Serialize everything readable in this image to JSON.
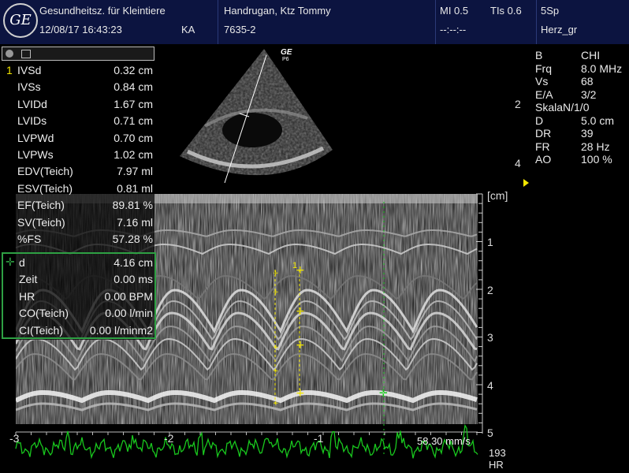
{
  "header": {
    "logo_text": "GE",
    "institution": "Gesundheitsz. für Kleintiere",
    "datetime": "12/08/17 16:43:23",
    "operator": "KA",
    "patient": "Handrugan, Ktz Tommy",
    "patient_id": "7635-2",
    "mi": "MI 0.5",
    "tis": "TIs 0.6",
    "placeholder": "--:--:--",
    "probe": "5Sp",
    "preset": "Herz_gr"
  },
  "probe_label": {
    "brand": "GE",
    "sub": "P6"
  },
  "measurements": [
    {
      "index": "1",
      "label": "IVSd",
      "value": "0.32 cm"
    },
    {
      "index": "",
      "label": "IVSs",
      "value": "0.84 cm"
    },
    {
      "index": "",
      "label": "LVIDd",
      "value": "1.67 cm"
    },
    {
      "index": "",
      "label": "LVIDs",
      "value": "0.71 cm"
    },
    {
      "index": "",
      "label": "LVPWd",
      "value": "0.70 cm"
    },
    {
      "index": "",
      "label": "LVPWs",
      "value": "1.02 cm"
    },
    {
      "index": "",
      "label": "EDV(Teich)",
      "value": "7.97 ml"
    },
    {
      "index": "",
      "label": "ESV(Teich)",
      "value": "0.81 ml"
    },
    {
      "index": "",
      "label": "EF(Teich)",
      "value": "89.81 %"
    },
    {
      "index": "",
      "label": "SV(Teich)",
      "value": "7.16 ml"
    },
    {
      "index": "",
      "label": "%FS",
      "value": "57.28 %"
    }
  ],
  "calipers": [
    {
      "label": "d",
      "value": "4.16 cm"
    },
    {
      "label": "Zeit",
      "value": "0.00 ms"
    },
    {
      "label": "HR",
      "value": "0.00 BPM"
    },
    {
      "label": "CO(Teich)",
      "value": "0.00 l/min"
    },
    {
      "label": "CI(Teich)",
      "value": "0.00 l/minm2"
    }
  ],
  "params": [
    {
      "label": "B",
      "value": "CHI"
    },
    {
      "label": "Frq",
      "value": "8.0 MHz"
    },
    {
      "label": "Vs",
      "value": "68"
    },
    {
      "label": "E/A",
      "value": "3/2"
    },
    {
      "label": "SkalaN/1/0",
      "value": ""
    },
    {
      "label": "D",
      "value": "5.0 cm"
    },
    {
      "label": "DR",
      "value": "39"
    },
    {
      "label": "FR",
      "value": "28 Hz"
    },
    {
      "label": "AO",
      "value": "100 %"
    }
  ],
  "side_scale": [
    "2",
    "4"
  ],
  "depth_unit": "[cm]",
  "depth_marks": [
    "1",
    "2",
    "3",
    "4",
    "5"
  ],
  "time_marks": [
    "-3",
    "-2",
    "-1"
  ],
  "sweep_speed": "58.30 mm/s",
  "caliper_marker": "1",
  "heart_rate": {
    "value": "193",
    "label": "HR"
  },
  "colors": {
    "header_bg": "#0c1440",
    "caliper_yellow": "#f2e600",
    "panel_border": "#2ea043",
    "ecg_green": "#19c81e"
  }
}
